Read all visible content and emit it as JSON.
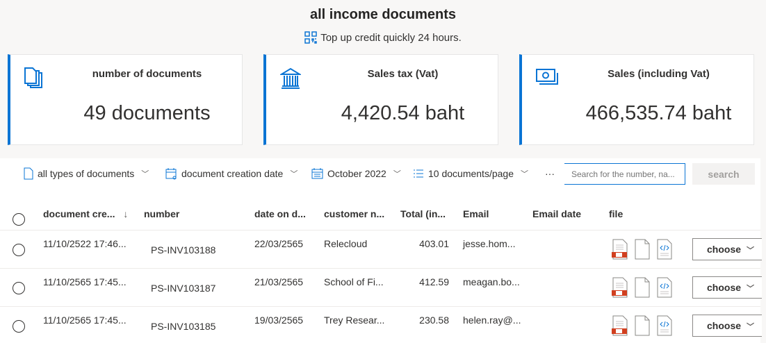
{
  "header": {
    "title": "all income documents",
    "subtitle": "Top up credit quickly 24 hours."
  },
  "cards": [
    {
      "label": "number of documents",
      "value": "49 documents",
      "icon": "documents-icon"
    },
    {
      "label": "Sales tax (Vat)",
      "value": "4,420.54 baht",
      "icon": "bank-icon"
    },
    {
      "label": "Sales (including Vat)",
      "value": "466,535.74 baht",
      "icon": "money-icon"
    }
  ],
  "toolbar": {
    "doc_type": "all types of documents",
    "date_field": "document creation date",
    "month": "October 2022",
    "page_size": "10 documents/page",
    "more": "···",
    "search_placeholder": "Search for the number, na...",
    "search_label": "search"
  },
  "table": {
    "columns": [
      "document cre...",
      "number",
      "date on d...",
      "customer n...",
      "Total (in...",
      "Email",
      "Email date",
      "file"
    ],
    "rows": [
      {
        "created": "11/10/2522 17:46...",
        "number": "PS-INV103188",
        "date": "22/03/2565",
        "customer": "Relecloud",
        "total": "403.01",
        "email": "jesse.hom...",
        "email_date": "",
        "action": "choose"
      },
      {
        "created": "11/10/2565 17:45...",
        "number": "PS-INV103187",
        "date": "21/03/2565",
        "customer": "School of Fi...",
        "total": "412.59",
        "email": "meagan.bo...",
        "email_date": "",
        "action": "choose"
      },
      {
        "created": "11/10/2565 17:45...",
        "number": "PS-INV103185",
        "date": "19/03/2565",
        "customer": "Trey Resear...",
        "total": "230.58",
        "email": "helen.ray@...",
        "email_date": "",
        "action": "choose"
      }
    ]
  },
  "colors": {
    "accent": "#0a74d4",
    "pdf": "#d13f1f"
  }
}
